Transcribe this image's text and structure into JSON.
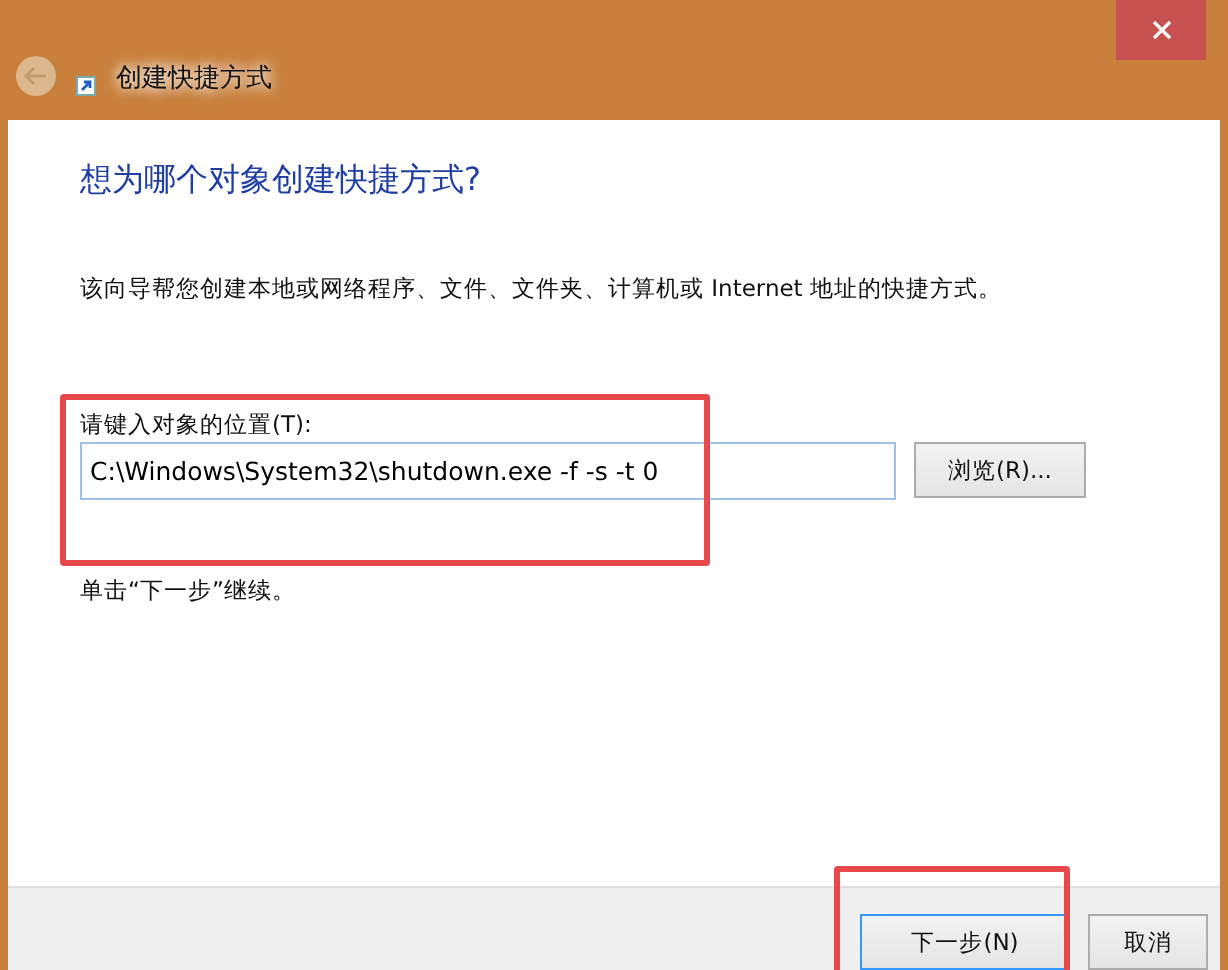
{
  "window": {
    "title": "创建快捷方式",
    "back_enabled": false
  },
  "heading": "想为哪个对象创建快捷方式?",
  "description": "该向导帮您创建本地或网络程序、文件、文件夹、计算机或 Internet 地址的快捷方式。",
  "location": {
    "label": "请键入对象的位置(T):",
    "value": "C:\\Windows\\System32\\shutdown.exe -f -s -t 0",
    "browse_button": "浏览(R)..."
  },
  "hint": "单击“下一步”继续。",
  "buttons": [
    {
      "label": "下一步(N)",
      "default": true
    },
    {
      "label": "取消",
      "default": false
    }
  ]
}
